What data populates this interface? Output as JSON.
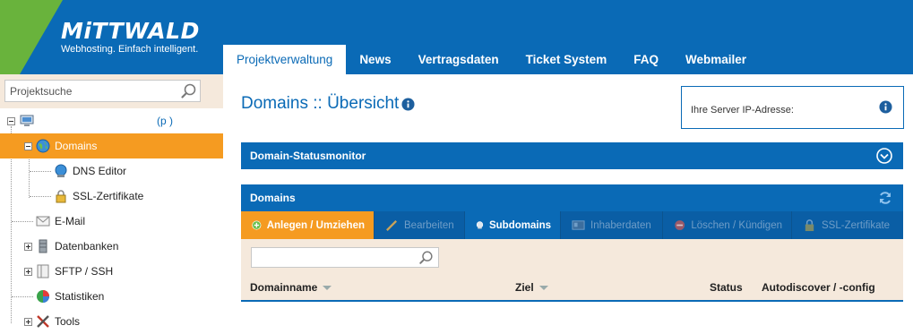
{
  "brand": {
    "name": "MiTTWALD",
    "tagline": "Webhosting. Einfach intelligent.",
    "colors": {
      "primary_blue": "#0a6ab6",
      "accent_orange": "#f59b21",
      "green": "#69b33c",
      "panel_beige": "#f5e9dc"
    }
  },
  "nav": {
    "tabs": [
      {
        "label": "Projektverwaltung",
        "active": true
      },
      {
        "label": "News"
      },
      {
        "label": "Vertragsdaten"
      },
      {
        "label": "Ticket System"
      },
      {
        "label": "FAQ"
      },
      {
        "label": "Webmailer"
      }
    ]
  },
  "sidebar": {
    "search_placeholder": "Projektsuche",
    "project_suffix": "(p          )",
    "items": [
      {
        "label": "Domains",
        "icon": "globe-icon",
        "active": true
      },
      {
        "label": "DNS Editor",
        "icon": "dns-icon"
      },
      {
        "label": "SSL-Zertifikate",
        "icon": "lock-icon"
      },
      {
        "label": "E-Mail",
        "icon": "envelope-icon"
      },
      {
        "label": "Datenbanken",
        "icon": "database-icon"
      },
      {
        "label": "SFTP / SSH",
        "icon": "server-icon"
      },
      {
        "label": "Statistiken",
        "icon": "pie-chart-icon"
      },
      {
        "label": "Tools",
        "icon": "tools-icon"
      }
    ]
  },
  "main": {
    "title": "Domains :: Übersicht",
    "ip_box_label": "Ihre Server IP-Adresse:",
    "status_panel_title": "Domain-Statusmonitor",
    "domains_panel_title": "Domains",
    "toolbar": {
      "add": "Anlegen / Umziehen",
      "edit": "Bearbeiten",
      "subdomains": "Subdomains",
      "owner": "Inhaberdaten",
      "delete": "Löschen / Kündigen",
      "ssl": "SSL-Zertifikate"
    },
    "table": {
      "columns": [
        "Domainname",
        "Ziel",
        "Status",
        "Autodiscover / -config"
      ]
    }
  }
}
